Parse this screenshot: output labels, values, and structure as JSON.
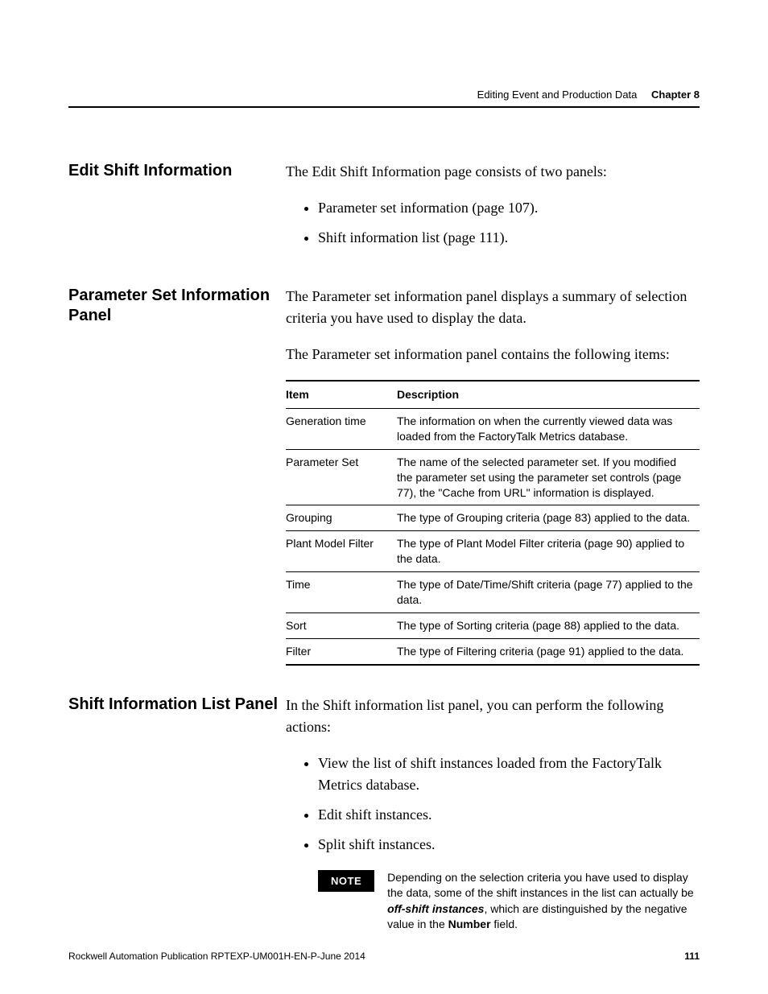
{
  "runningHead": {
    "title": "Editing Event and Production Data",
    "chapter": "Chapter 8"
  },
  "section1": {
    "heading": "Edit Shift Information",
    "intro": "The Edit Shift Information page consists of two panels:",
    "bullets": [
      "Parameter set information (page 107).",
      "Shift information list (page 111)."
    ]
  },
  "section2": {
    "heading": "Parameter Set Information Panel",
    "p1": "The Parameter set information panel displays a summary of selection criteria you have used to display the data.",
    "p2": "The Parameter set information panel contains the following items:",
    "table": {
      "head": {
        "c1": "Item",
        "c2": "Description"
      },
      "rows": [
        {
          "c1": "Generation time",
          "c2": "The information on when the currently viewed data was loaded from the FactoryTalk Metrics database."
        },
        {
          "c1": "Parameter Set",
          "c2": "The name of the selected parameter set.\nIf you modified the parameter set using the parameter set controls (page 77), the \"Cache from URL\" information is displayed."
        },
        {
          "c1": "Grouping",
          "c2": "The type of Grouping criteria (page 83) applied to the data."
        },
        {
          "c1": "Plant Model Filter",
          "c2": "The type of Plant Model Filter criteria (page 90) applied to the data."
        },
        {
          "c1": "Time",
          "c2": "The type of Date/Time/Shift criteria (page 77) applied to the data."
        },
        {
          "c1": "Sort",
          "c2": "The type of Sorting criteria (page 88) applied to the data."
        },
        {
          "c1": "Filter",
          "c2": "The type of Filtering criteria (page 91) applied to the data."
        }
      ]
    }
  },
  "section3": {
    "heading": "Shift Information List Panel",
    "intro": "In the Shift information list panel, you can perform the following actions:",
    "bullets": [
      "View the list of shift instances loaded from the FactoryTalk Metrics database.",
      "Edit shift instances.",
      "Split shift instances."
    ],
    "note": {
      "label": "NOTE",
      "pre": "Depending on the selection criteria you have used to display the data, some of the shift instances in the list can actually be ",
      "em1": "off-shift instances",
      "mid": ", which are distinguished by the negative value in the ",
      "em2": "Number",
      "post": " field."
    }
  },
  "footer": {
    "pub": "Rockwell Automation Publication RPTEXP-UM001H-EN-P-June 2014",
    "page": "111"
  }
}
